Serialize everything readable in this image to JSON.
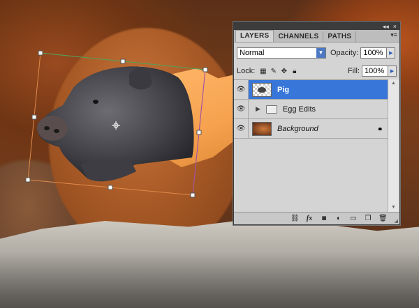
{
  "panel": {
    "tabs": [
      "LAYERS",
      "CHANNELS",
      "PATHS"
    ],
    "blend_mode": "Normal",
    "opacity_label": "Opacity:",
    "opacity_value": "100%",
    "lock_label": "Lock:",
    "fill_label": "Fill:",
    "fill_value": "100%",
    "layers": [
      {
        "name": "Pig",
        "selected": true
      },
      {
        "name": "Egg Edits",
        "group": true
      },
      {
        "name": "Background",
        "locked": true
      }
    ],
    "accent_color": "#3877d9"
  },
  "icons": {
    "lock": [
      "transparency-lock-icon",
      "brush-lock-icon",
      "move-lock-icon",
      "padlock-icon"
    ],
    "bottom": [
      "link-layers-icon",
      "fx-icon",
      "add-mask-icon",
      "adjustment-layer-icon",
      "new-group-icon",
      "new-layer-icon",
      "trash-icon"
    ]
  }
}
